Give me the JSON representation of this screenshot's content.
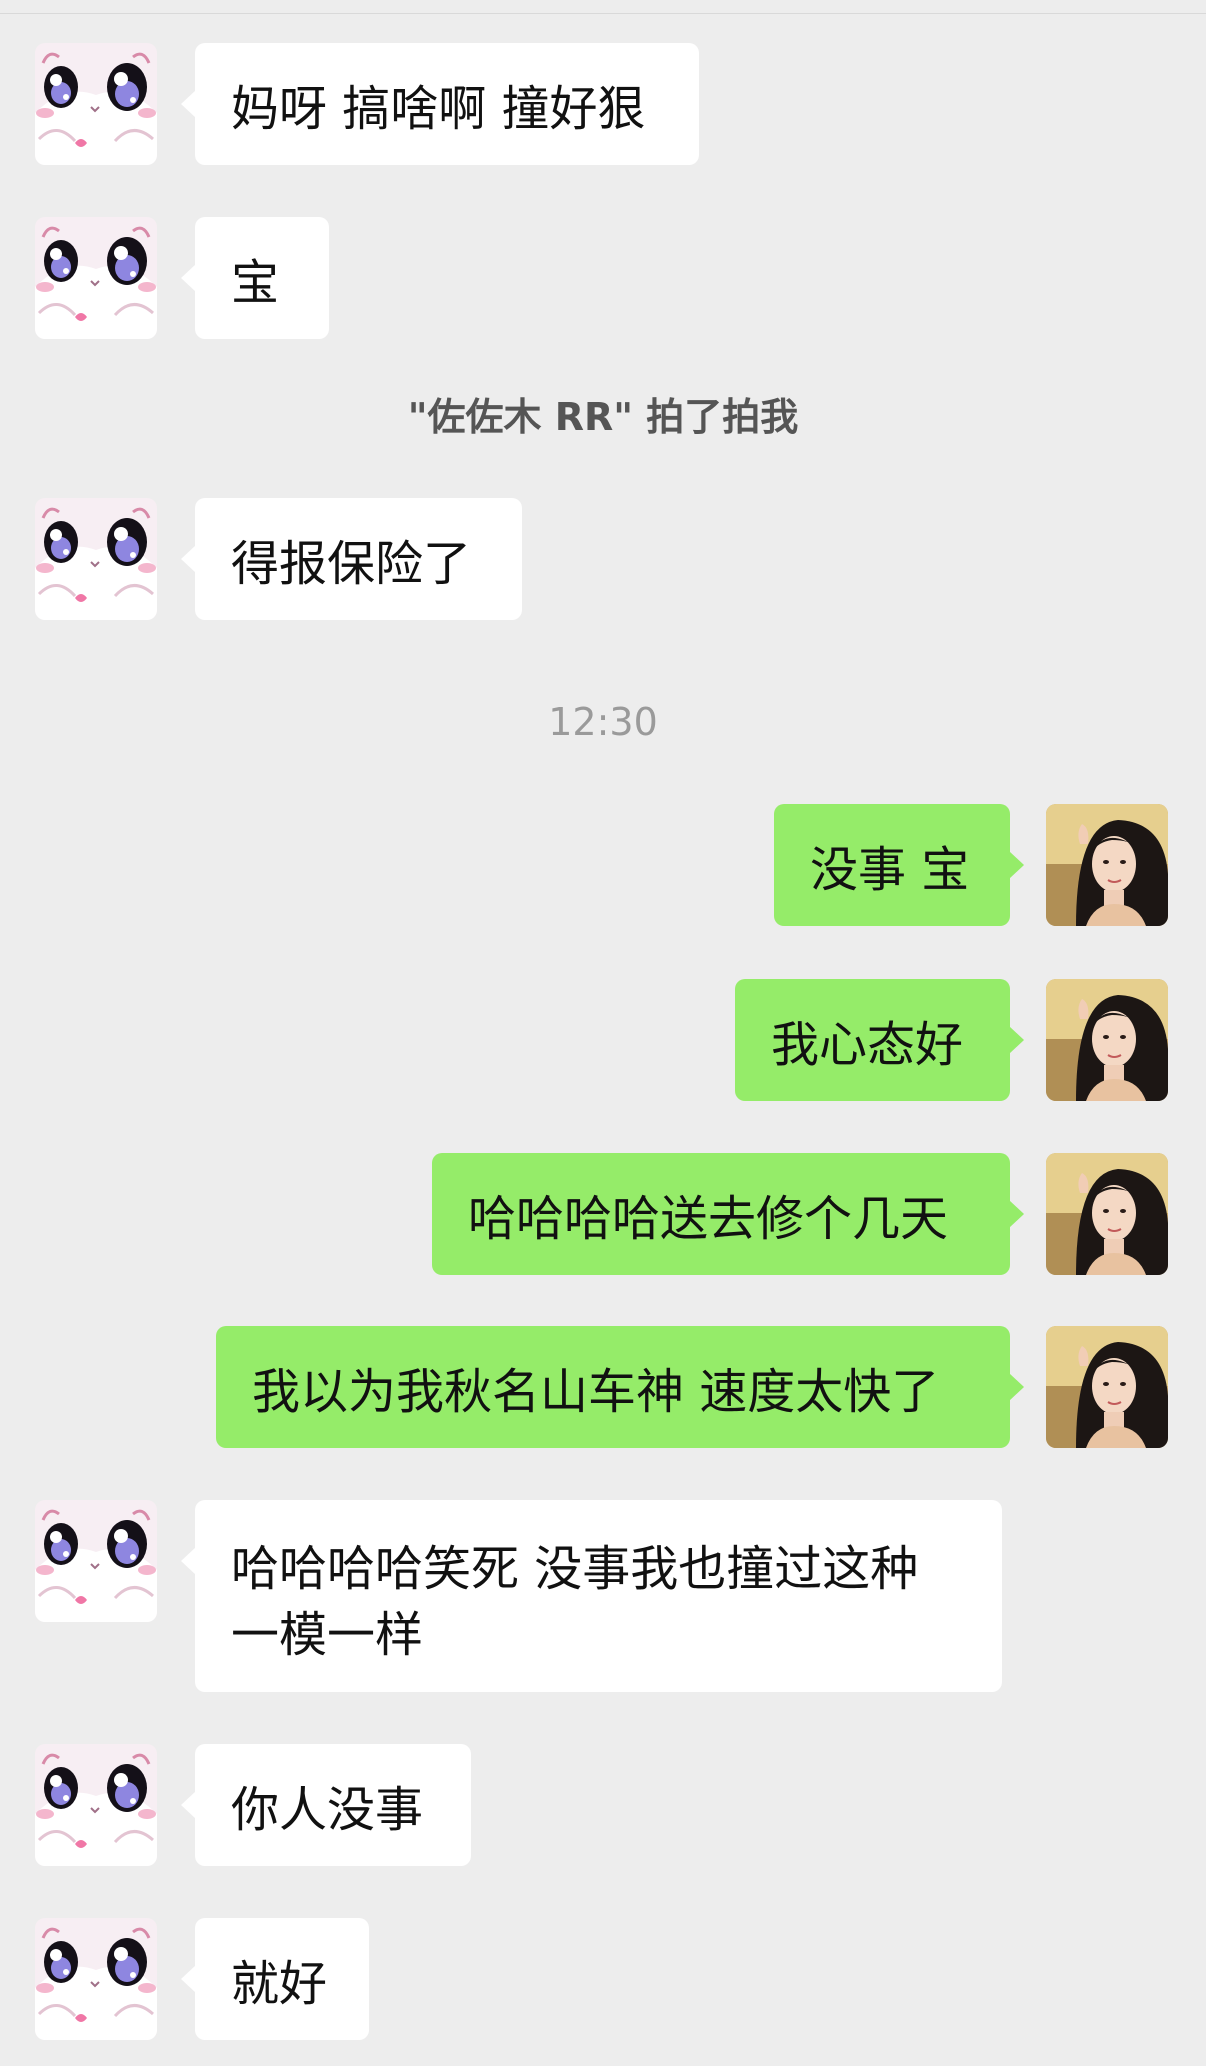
{
  "theme": {
    "background": "#ededed",
    "incoming_bubble": "#ffffff",
    "outgoing_bubble": "#95ec69",
    "system_text": "#555555",
    "timestamp_text": "#9a9a9a"
  },
  "avatars": {
    "contact": "cartoon-cat-avatar",
    "self": "selfie-photo-avatar"
  },
  "messages": [
    {
      "sender": "contact",
      "text": "妈呀 搞啥啊 撞好狠"
    },
    {
      "sender": "contact",
      "text": "宝"
    },
    {
      "type": "system",
      "text": "\"佐佐木 RR\" 拍了拍我"
    },
    {
      "sender": "contact",
      "text": "得报保险了"
    },
    {
      "type": "time",
      "text": "12:30"
    },
    {
      "sender": "self",
      "text": "没事 宝"
    },
    {
      "sender": "self",
      "text": "我心态好"
    },
    {
      "sender": "self",
      "text": "哈哈哈哈送去修个几天"
    },
    {
      "sender": "self",
      "text": "我以为我秋名山车神 速度太快了"
    },
    {
      "sender": "contact",
      "text": "哈哈哈哈笑死 没事我也撞过这种一模一样"
    },
    {
      "sender": "contact",
      "text": "你人没事"
    },
    {
      "sender": "contact",
      "text": "就好"
    }
  ]
}
